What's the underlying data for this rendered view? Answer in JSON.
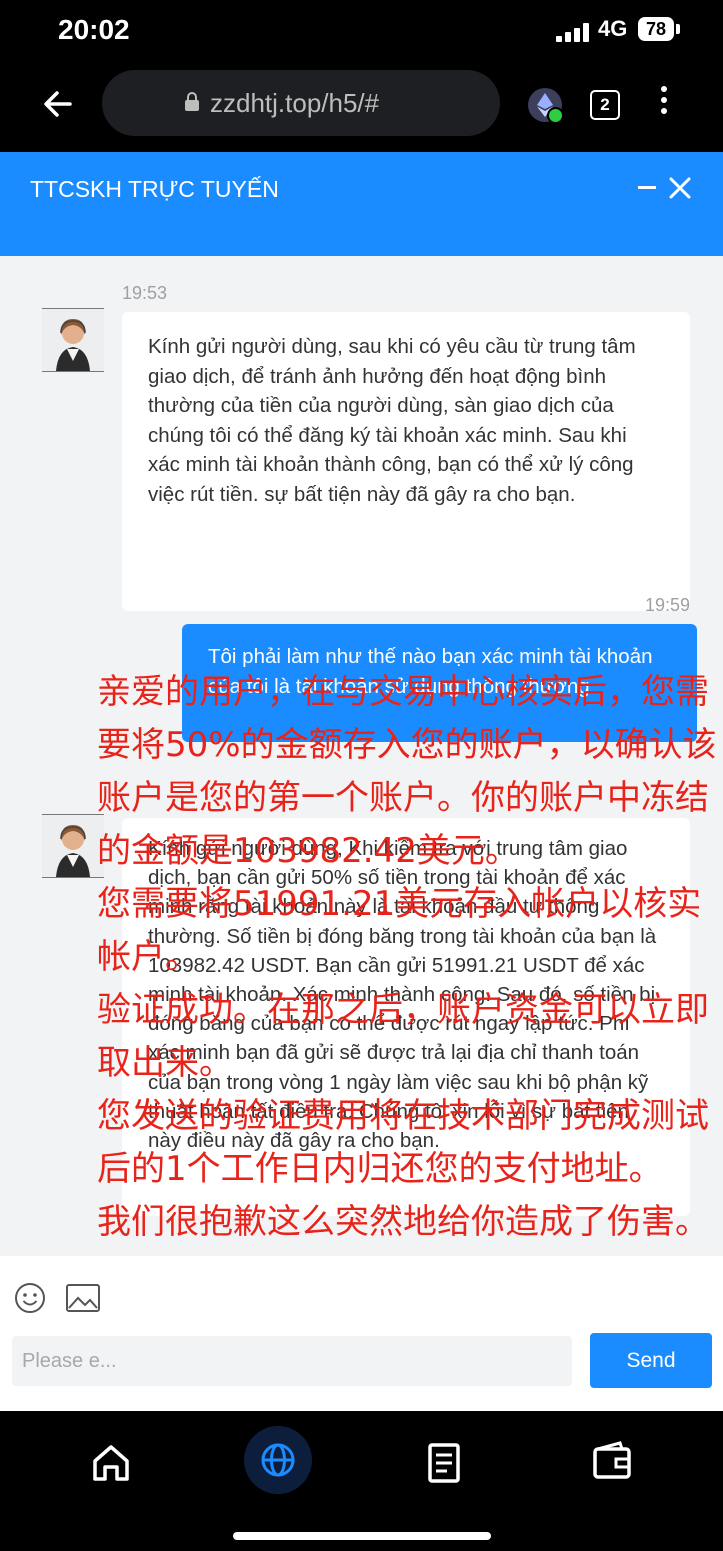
{
  "status_bar": {
    "time": "20:02",
    "network": "4G",
    "battery": "78"
  },
  "browser": {
    "url": "zzdhtj.top/h5/#",
    "tab_count": "2"
  },
  "chat_header": {
    "title": "TTCSKH TRỰC TUYẾN"
  },
  "messages": [
    {
      "time": "19:53",
      "text": "Kính gửi người dùng, sau khi có yêu cầu từ trung tâm giao dịch, để tránh ảnh hưởng đến hoạt động bình thường của tiền của người dùng, sàn giao dịch của chúng tôi có thể đăng ký tài khoản xác minh. Sau khi xác minh tài khoản thành công, bạn có thể xử lý công việc rút tiền. sự bất tiện này đã gây ra cho bạn."
    },
    {
      "time": "19:59",
      "text": "Tôi phải làm như thế nào bạn xác minh tài khoản của tôi là tài khoản sử dụng thông thường"
    },
    {
      "text": "Kính gửi người dùng, Khi kiểm tra với trung tâm giao dịch, bạn cần gửi 50% số tiền trong tài khoản để xác minh rằng tài khoản này là tài khoản đầu tư thông thường. Số tiền bị đóng băng trong tài khoản của bạn là 103982.42 USDT. Bạn cần gửi 51991.21 USDT để xác minh tài khoản. Xác minh thành công. Sau đó, số tiền bị đóng băng của bạn có thể được rút ngay lập tức. Phí xác minh bạn đã gửi sẽ được trả lại địa chỉ thanh toán của bạn trong vòng 1 ngày làm việc sau khi bộ phận kỹ thuật hoàn tất điều tra. Chúng tôi xin lỗi vì sự bất tiện này điều này đã gây ra cho bạn."
    }
  ],
  "input": {
    "placeholder": "Please e...",
    "send_label": "Send"
  },
  "overlay_annotation": [
    "亲爱的用户，在与交易中心核实后，您需要将50%的金额存入您的账户，以确认该账户是您的第一个账户。你的账户中冻结的金额是103982.42美元。",
    "您需要将51991.21美元存入帐户以核实帐户。",
    "验证成功。在那之后，账户资金可以立即取出来。",
    "您发送的验证费用将在技术部门完成测试后的1个工作日内归还您的支付地址。",
    "我们很抱歉这么突然地给你造成了伤害。"
  ],
  "colors": {
    "accent": "#1a8cff",
    "overlay_text": "#e8231a",
    "chat_bg": "#f2f3f5"
  },
  "icons": [
    "back-arrow-icon",
    "lock-icon",
    "ethereum-icon",
    "tabs-icon",
    "more-icon",
    "minimize-icon",
    "close-icon",
    "emoji-icon",
    "image-icon",
    "home-icon",
    "globe-icon",
    "document-icon",
    "wallet-icon"
  ]
}
